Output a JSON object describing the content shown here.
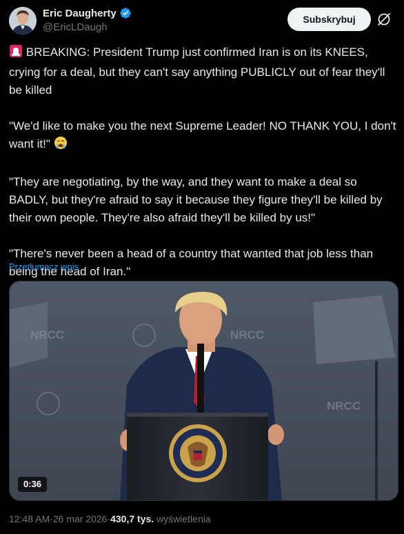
{
  "author": {
    "display_name": "Eric Daugherty",
    "handle": "@EricLDaugh",
    "verified": true
  },
  "actions": {
    "subscribe_label": "Subskrybuj",
    "grok_icon": "grok-slash-icon"
  },
  "post": {
    "paragraphs": [
      {
        "prefix_icon": "siren-emoji",
        "text": "BREAKING: President Trump just confirmed Iran is on its KNEES, crying for a deal, but they can't say anything PUBLICLY out of fear they'll be killed"
      },
      {
        "text": "\"We'd like to make you the next Supreme Leader! NO THANK YOU, I don't want it!\"",
        "suffix_icon": "loudly-crying-emoji"
      },
      {
        "text": "\"They are negotiating, by the way, and they want to make a deal so BADLY, but they're afraid to say it because they figure they'll be killed by their own people. They're also afraid they'll be killed by us!\""
      },
      {
        "text": "\"There's never been a head of a country that wanted that job less than being the head of Iran.\""
      }
    ],
    "translate_label": "Przetłumacz wpis"
  },
  "media": {
    "duration": "0:36",
    "backdrop_text": "NRCC",
    "seal_text": "SEAL OF THE PRESIDENT OF THE UNITED STATES"
  },
  "meta": {
    "time": "12:48 AM",
    "separator": " · ",
    "date": "26 mar 2026",
    "views_count": "430,7 tys.",
    "views_label": "wyświetlenia"
  }
}
